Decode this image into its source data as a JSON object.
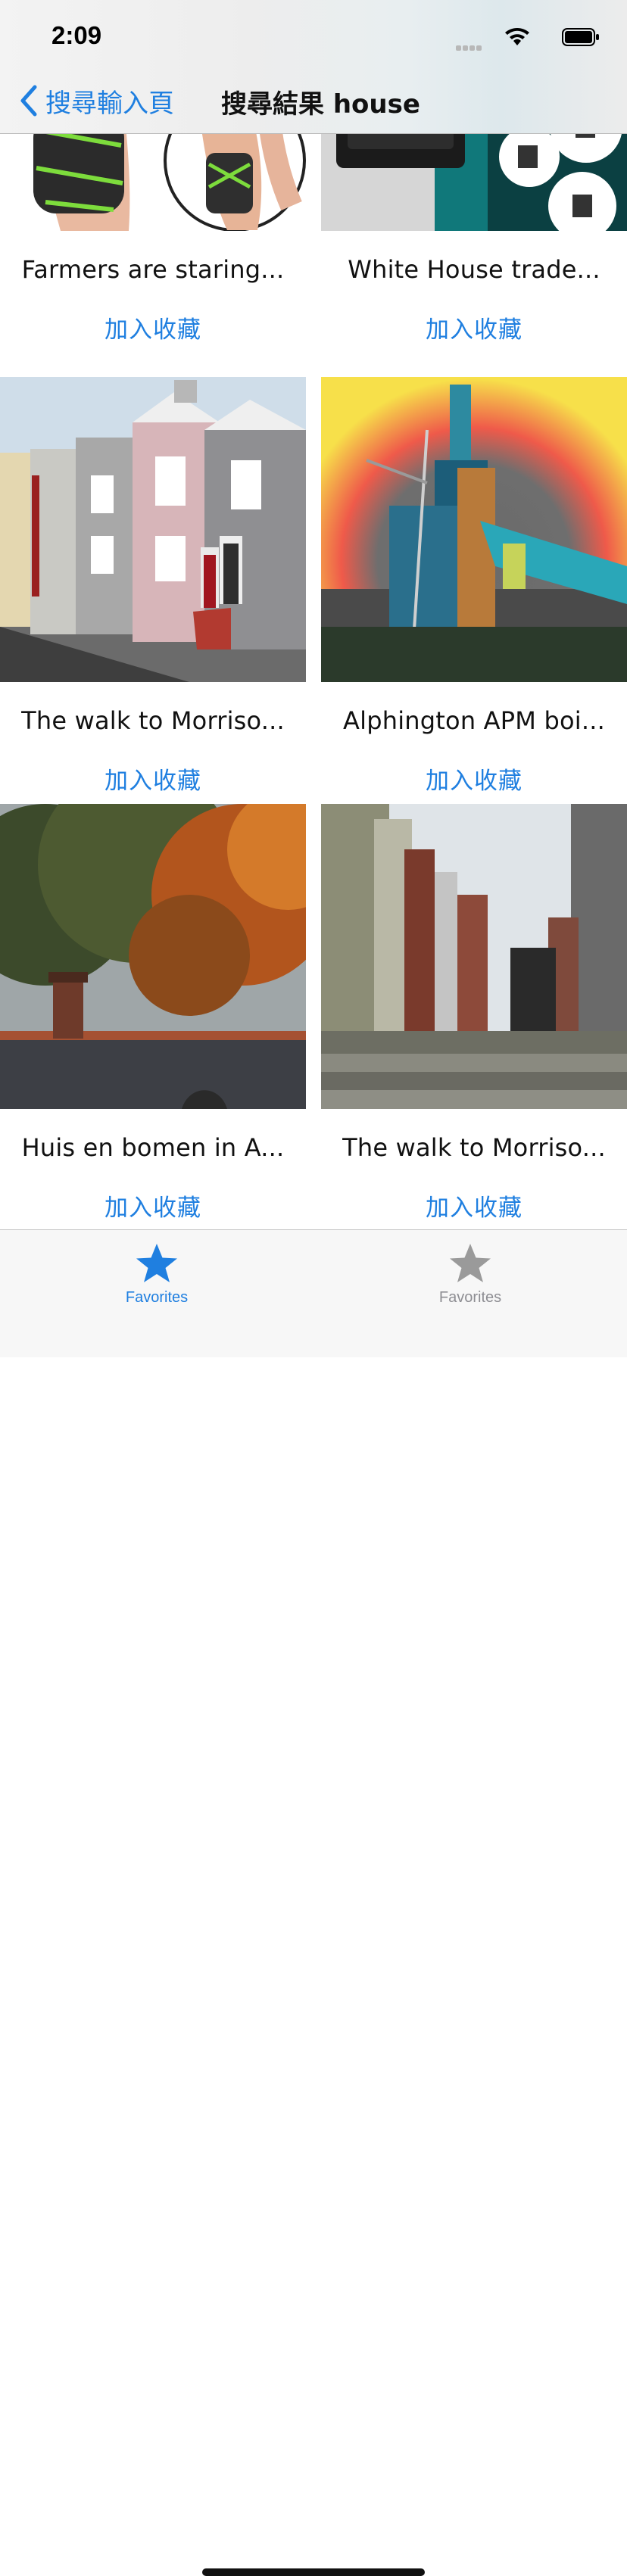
{
  "status_bar": {
    "time": "2:09"
  },
  "nav": {
    "back_label": "搜尋輸入頁",
    "title": "搜尋結果 house"
  },
  "results": [
    {
      "caption": "Farmers are staring...",
      "favorite_label": "加入收藏",
      "image": "knee-brace-green"
    },
    {
      "caption": "White House trade...",
      "favorite_label": "加入收藏",
      "image": "knee-brace-black"
    },
    {
      "caption": "The walk to Morriso...",
      "favorite_label": "加入收藏",
      "image": "terraced-houses"
    },
    {
      "caption": "Alphington APM boi...",
      "favorite_label": "加入收藏",
      "image": "industrial-building"
    },
    {
      "caption": "Huis en bomen in A...",
      "favorite_label": "加入收藏",
      "image": "autumn-trees-roof"
    },
    {
      "caption": "The walk to Morriso...",
      "favorite_label": "加入收藏",
      "image": "street-steps"
    }
  ],
  "tabbar": {
    "tabs": [
      {
        "label": "Favorites",
        "icon": "star-icon",
        "selected": true
      },
      {
        "label": "Favorites",
        "icon": "star-icon",
        "selected": false
      }
    ]
  },
  "colors": {
    "accent": "#1f7fe0",
    "tab_inactive": "#8e8e93"
  }
}
